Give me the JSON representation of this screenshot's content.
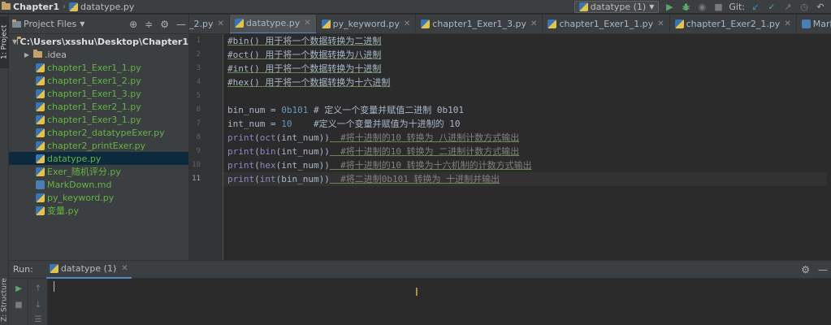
{
  "titlebar": {
    "breadcrumb_root": "Chapter1",
    "breadcrumb_file": "datatype.py",
    "run_config": "datatype (1)",
    "git_label": "Git:"
  },
  "left_strip": {
    "project_tab": "1: Project",
    "structure_tab": "Z: Structure"
  },
  "project_panel": {
    "title": "Project Files",
    "root": "C:\\Users\\xsshu\\Desktop\\Chapter1",
    "items": [
      {
        "label": ".idea",
        "type": "folder"
      },
      {
        "label": "chapter1_Exer1_1.py",
        "type": "file"
      },
      {
        "label": "chapter1_Exer1_2.py",
        "type": "file"
      },
      {
        "label": "chapter1_Exer1_3.py",
        "type": "file"
      },
      {
        "label": "chapter1_Exer2_1.py",
        "type": "file"
      },
      {
        "label": "chapter1_Exer3_1.py",
        "type": "file"
      },
      {
        "label": "chapter2_datatypeExer.py",
        "type": "file"
      },
      {
        "label": "chapter2_printExer.py",
        "type": "file"
      },
      {
        "label": "datatype.py",
        "type": "file",
        "selected": true
      },
      {
        "label": "Exer_随机评分.py",
        "type": "file"
      },
      {
        "label": "MarkDown.md",
        "type": "md"
      },
      {
        "label": "py_keyword.py",
        "type": "file"
      },
      {
        "label": "变量.py",
        "type": "file"
      }
    ]
  },
  "tabs": [
    {
      "label": "_2.py",
      "active": false
    },
    {
      "label": "datatype.py",
      "active": true
    },
    {
      "label": "py_keyword.py",
      "active": false
    },
    {
      "label": "chapter1_Exer1_3.py",
      "active": false
    },
    {
      "label": "chapter1_Exer1_1.py",
      "active": false
    },
    {
      "label": "chapter1_Exer2_1.py",
      "active": false
    },
    {
      "label": "MarkDown.md",
      "active": false
    }
  ],
  "editor": {
    "line_numbers": [
      "1",
      "2",
      "3",
      "4",
      "5",
      "6",
      "7",
      "8",
      "9",
      "10",
      "11"
    ],
    "current_line": 11,
    "lines": {
      "l1": "#bin() 用于将一个数据转换为二进制",
      "l2": "#oct() 用于将一个数据转换为八进制",
      "l3": "#int() 用于将一个数据转换为十进制",
      "l4": "#hex() 用于将一个数据转换为十六进制",
      "l6_a": "bin_num = ",
      "l6_b": "0b101",
      "l6_c": " # 定义一个变量并赋值二进制 0b101",
      "l7_a": "int_num = ",
      "l7_b": "10",
      "l7_c": "    #定义一个变量并赋值为十进制的 10",
      "l8_a": "print",
      "l8_b": "(",
      "l8_c": "oct",
      "l8_d": "(int_num))",
      "l8_e": "  #将十进制的10 转换为 八进制计数方式输出",
      "l9_a": "print",
      "l9_b": "(",
      "l9_c": "bin",
      "l9_d": "(int_num))",
      "l9_e": "  #将十进制的10 转换为 二进制计数方式输出",
      "l10_a": "print",
      "l10_b": "(",
      "l10_c": "hex",
      "l10_d": "(int_num))",
      "l10_e": "  #将十进制的10 转换为十六机制的计数方式输出",
      "l11_a": "print",
      "l11_b": "(",
      "l11_c": "int",
      "l11_d": "(bin_num))",
      "l11_e": "  #将二进制0b101 转换为 十进制并输出"
    }
  },
  "run_panel": {
    "label": "Run:",
    "tab": "datatype (1)"
  },
  "colors": {
    "background": "#2b2b2b",
    "panel": "#3c3f41",
    "selection": "#0d293e",
    "module_green": "#62b543",
    "keyword_orange": "#cc7832",
    "number_blue": "#6897bb",
    "builtin_purple": "#8888c6",
    "accent_blue": "#4a88c7"
  },
  "icons": {
    "run": "play-icon",
    "debug": "bug-icon",
    "settings": "gear-icon",
    "hide": "minimize-icon"
  }
}
